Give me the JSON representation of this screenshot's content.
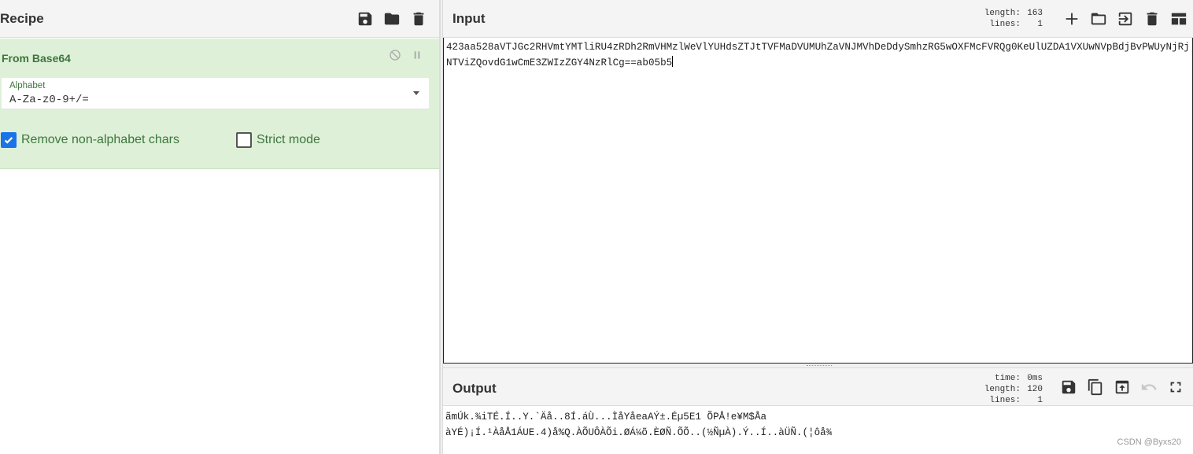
{
  "recipe": {
    "title": "Recipe",
    "operation": {
      "name": "From Base64",
      "alphabet_label": "Alphabet",
      "alphabet_value": "A-Za-z0-9+/=",
      "remove_non_alpha_label": "Remove non-alphabet chars",
      "remove_non_alpha_checked": true,
      "strict_mode_label": "Strict mode",
      "strict_mode_checked": false
    }
  },
  "input": {
    "title": "Input",
    "length_label": "length:",
    "length_value": "163",
    "lines_label": "lines:",
    "lines_value": "1",
    "text": "423aa528aVTJGc2RHVmtYMTliRU4zRDh2RmVHMzlWeVlYUHdsZTJtTVFMaDVUMUhZaVNJMVhDeDdySmhzRG5wOXFMcFVRQg0KeUlUZDA1VXUwNVpBdjBvPWUyNjRjNTViZQovdG1wCmE3ZWIzZGY4NzRlCg==ab05b5"
  },
  "output": {
    "title": "Output",
    "time_label": "time:",
    "time_value": "0ms",
    "length_label": "length:",
    "length_value": "120",
    "lines_label": "lines:",
    "lines_value": "1",
    "line1": "ãmÚk.¾iTÉ.Í..Y.`Äå..8Í.áÙ...ÌåYåeaAÝ±.Éµ5E1 ÕPÅ!e¥M$Åa",
    "line2": "àYÉ)¡Í.¹ÀåÅ1ÁUE.4)å%Q.ÀÕUÔÀÕi.ØÁ¼õ.ÈØÑ.ÕÕ..(½ÑµÀ).Ý..Í..àÜÑ.(¦ôå¾"
  },
  "watermark": "CSDN @Byxs20",
  "colors": {
    "op_bg": "#dff0d8",
    "op_text": "#3c763d",
    "checkbox_on": "#1a73e8"
  }
}
